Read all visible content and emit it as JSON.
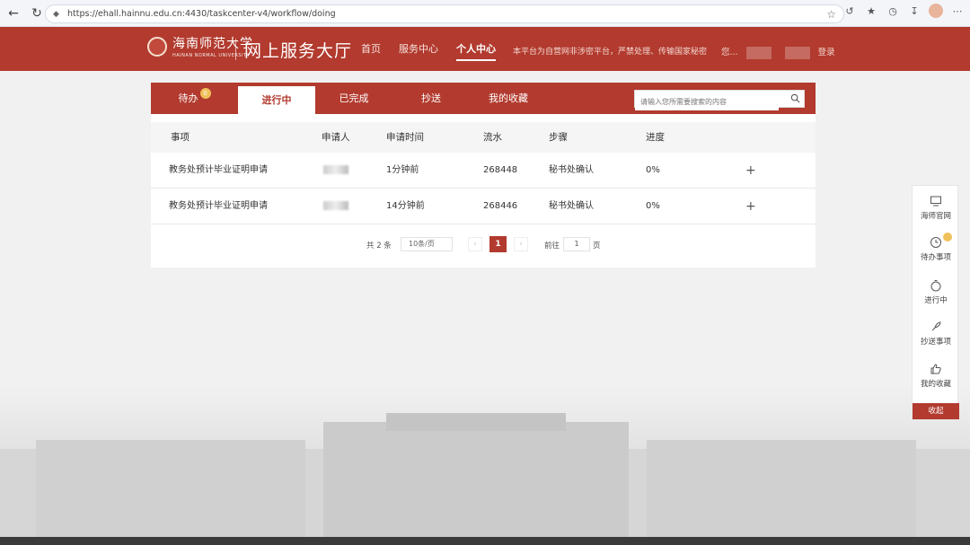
{
  "browser": {
    "url": "https://ehall.hainnu.edu.cn:4430/taskcenter-v4/workflow/doing"
  },
  "header": {
    "logo_cn": "海南师范大学",
    "logo_en": "HAINAN NORMAL UNIVERSITY",
    "site_title": "网上服务大厅",
    "nav": [
      {
        "label": "首页",
        "active": false
      },
      {
        "label": "服务中心",
        "active": false
      },
      {
        "label": "个人中心",
        "active": true
      }
    ],
    "slogan": "本平台为自营网非涉密平台，严禁处理、传输国家秘密",
    "user_prefix": "您...",
    "logout": "登录"
  },
  "tabs": [
    {
      "label": "待办",
      "active": false,
      "badge": "0"
    },
    {
      "label": "进行中",
      "active": true
    },
    {
      "label": "已完成",
      "active": false
    },
    {
      "label": "抄送",
      "active": false
    },
    {
      "label": "我的收藏",
      "active": false
    }
  ],
  "search": {
    "placeholder": "请输入您所需要搜索的内容"
  },
  "table": {
    "headers": [
      "事项",
      "申请人",
      "申请时间",
      "流水",
      "步骤",
      "进度"
    ],
    "rows": [
      {
        "item": "教务处预计毕业证明申请",
        "time": "1分钟前",
        "serial": "268448",
        "step": "秘书处确认",
        "progress": "0%"
      },
      {
        "item": "教务处预计毕业证明申请",
        "time": "14分钟前",
        "serial": "268446",
        "step": "秘书处确认",
        "progress": "0%"
      }
    ],
    "action_symbol": "+"
  },
  "pager": {
    "total": "共 2 条",
    "page_size": "10条/页",
    "current_page": "1",
    "goto_label": "前往",
    "goto_value": "1",
    "goto_suffix": "页"
  },
  "side": {
    "items": [
      {
        "label": "海师官网"
      },
      {
        "label": "待办事项"
      },
      {
        "label": "进行中"
      },
      {
        "label": "抄送事项"
      },
      {
        "label": "我的收藏"
      }
    ],
    "collapse": "收起"
  },
  "colors": {
    "brand": "#b23a2e",
    "badge": "#f0c15a"
  }
}
